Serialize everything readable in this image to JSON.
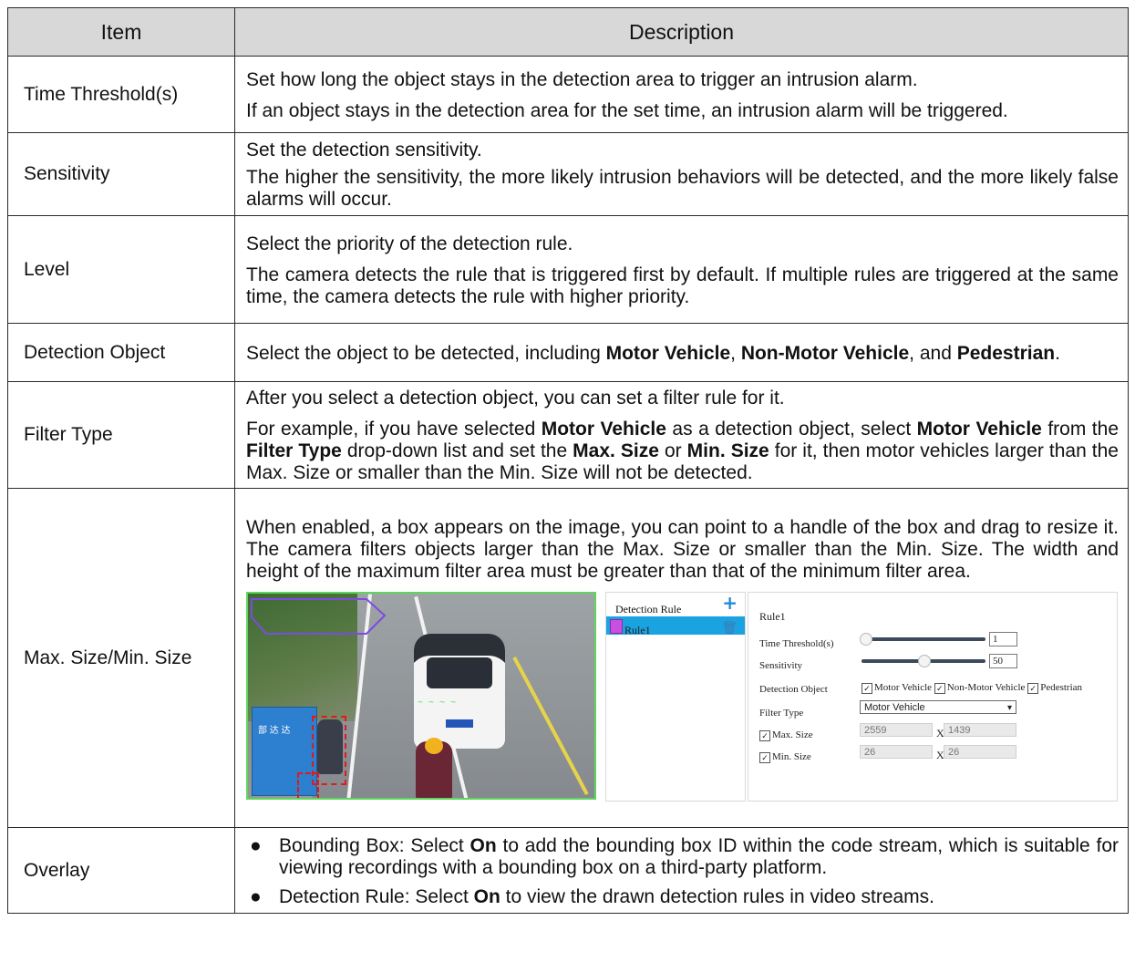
{
  "table": {
    "headers": {
      "item": "Item",
      "description": "Description"
    },
    "rows": {
      "time_threshold": {
        "item": "Time Threshold(s)",
        "p1": "Set how long the object stays in the detection area to trigger an intrusion alarm.",
        "p2": "If an object stays in the detection area for the set time, an intrusion alarm will be triggered."
      },
      "sensitivity": {
        "item": "Sensitivity",
        "p1": "Set the detection sensitivity.",
        "p2": "The higher the sensitivity, the more likely intrusion behaviors will be detected, and the more likely false alarms will occur."
      },
      "level": {
        "item": "Level",
        "p1": "Select the priority of the detection rule.",
        "p2": "The camera detects the rule that is triggered first by default. If multiple rules are triggered at the same time, the camera detects the rule with higher priority."
      },
      "detection_object": {
        "item": "Detection Object",
        "t1": "Select the object to be detected, including ",
        "b1": "Motor Vehicle",
        "t2": ", ",
        "b2": "Non-Motor Vehicle",
        "t3": ", and ",
        "b3": "Pedestrian",
        "t4": "."
      },
      "filter_type": {
        "item": "Filter Type",
        "p1": "After you select a detection object, you can set a filter rule for it.",
        "t1": "For example, if you have selected ",
        "b1": "Motor Vehicle",
        "t2": " as a detection object, select ",
        "b2": "Motor Vehicle",
        "t3": " from the ",
        "b3": "Filter Type",
        "t4": " drop-down list and set the ",
        "b4": "Max. Size",
        "t5": " or ",
        "b5": "Min. Size",
        "t6": " for it, then motor vehicles larger than the Max. Size or smaller than the Min. Size will not be detected."
      },
      "max_min_size": {
        "item": "Max. Size/Min. Size",
        "p1": "When enabled, a box appears on the image, you can point to a handle of the box and drag to resize it. The camera filters objects larger than the Max. Size or smaller than the Min. Size. The width and height of the maximum filter area must be greater than that of the minimum filter area."
      },
      "overlay": {
        "item": "Overlay",
        "bullet": "●",
        "li1_t1": "Bounding Box: Select ",
        "li1_b1": "On",
        "li1_t2": " to add the bounding box ID within the code stream, which is suitable for viewing recordings with a bounding box on a third-party platform.",
        "li2_t1": "Detection Rule: Select ",
        "li2_b1": "On",
        "li2_t2": " to view the drawn detection rules in video streams."
      }
    }
  },
  "figure": {
    "rule_panel": {
      "title": "Detection Rule",
      "add_icon": "plus-icon",
      "rule_name": "Rule1",
      "delete_icon": "trash-icon",
      "rule_color": "#c84fe0",
      "row_color": "#1aa3e0"
    },
    "settings": {
      "title": "Rule1",
      "time_threshold_label": "Time Threshold(s)",
      "time_threshold_value": "1",
      "sensitivity_label": "Sensitivity",
      "sensitivity_value": "50",
      "detection_object_label": "Detection Object",
      "obj_motor": "Motor Vehicle",
      "obj_nonmotor": "Non-Motor Vehicle",
      "obj_pedestrian": "Pedestrian",
      "filter_type_label": "Filter Type",
      "filter_type_value": "Motor Vehicle",
      "max_size_label": "Max. Size",
      "max_w": "2559",
      "x1": "X",
      "max_h": "1439",
      "min_size_label": "Min. Size",
      "min_w": "26",
      "x2": "X",
      "min_h": "26",
      "check": "✓",
      "dropdown_arrow": "▾"
    },
    "video": {
      "sign_text": "部 达 达 ",
      "detection_box_color": "#e01b1b",
      "border_color": "#5ed65e"
    }
  }
}
